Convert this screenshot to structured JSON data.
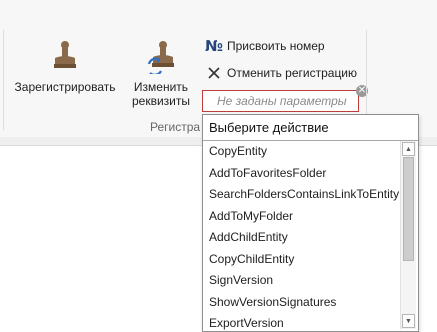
{
  "ribbon": {
    "register_label": "Зарегистрировать",
    "edit_details_label_1": "Изменить",
    "edit_details_label_2": "реквизиты",
    "assign_number_label": "Присвоить номер",
    "assign_number_glyph": "№",
    "cancel_registration_label": "Отменить регистрацию",
    "group_label": "Регистра",
    "combo_placeholder": "Не заданы параметры"
  },
  "dropdown": {
    "header": "Выберите действие",
    "items": [
      "CopyEntity",
      "AddToFavoritesFolder",
      "SearchFoldersContainsLinkToEntity",
      "AddToMyFolder",
      "AddChildEntity",
      "CopyChildEntity",
      "SignVersion",
      "ShowVersionSignatures",
      "ExportVersion"
    ]
  },
  "colors": {
    "stamp_brown": "#8a6a4a",
    "accent_blue": "#26467a",
    "error_red": "#c23b3b"
  },
  "icons": [
    "stamp-icon",
    "stamp-refresh-icon",
    "number-sign-icon",
    "close-icon",
    "clear-icon",
    "scroll-up-icon",
    "scroll-down-icon"
  ]
}
